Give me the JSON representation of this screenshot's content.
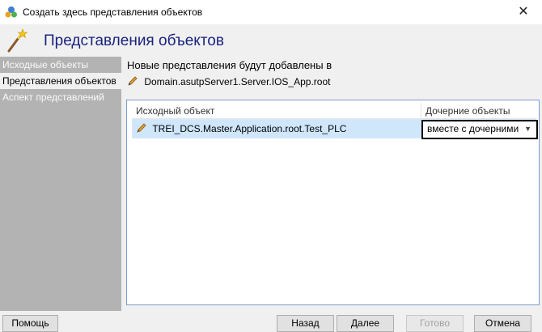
{
  "window": {
    "title": "Создать здесь представления объектов",
    "icon": "object-view-app-icon",
    "close_glyph": "✕"
  },
  "header": {
    "title": "Представления объектов",
    "icon": "magic-wand-icon"
  },
  "sidebar": {
    "items": [
      {
        "label": "Исходные объекты",
        "active": false
      },
      {
        "label": "Представления объектов",
        "active": true
      },
      {
        "label": "Аспект представлений",
        "active": false
      }
    ]
  },
  "main": {
    "intro": "Новые представления будут добавлены в",
    "target_path": "Domain.asutpServer1.Server.IOS_App.root",
    "grid": {
      "columns": [
        "Исходный объект",
        "Дочерние объекты"
      ],
      "rows": [
        {
          "source": "TREI_DCS.Master.Application.root.Test_PLC",
          "children": "вместе с дочерними"
        }
      ]
    }
  },
  "footer": {
    "help": "Помощь",
    "back": "Назад",
    "next": "Далее",
    "finish": "Готово",
    "cancel": "Отмена"
  },
  "colors": {
    "header_title": "#1a237e",
    "sidebar_bg": "#b3b3b3",
    "row_selected": "#cfe6fb"
  }
}
